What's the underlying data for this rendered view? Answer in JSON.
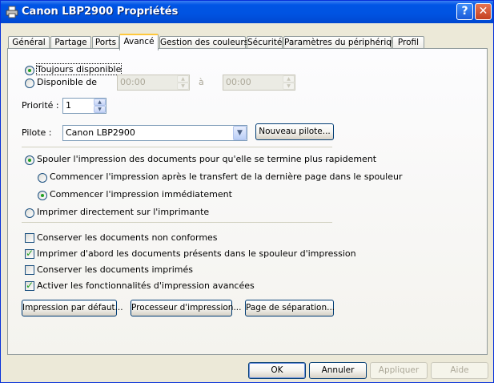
{
  "window": {
    "title": "Canon LBP2900 Propriétés",
    "help_label": "?",
    "close_label": "✕"
  },
  "tabs": [
    {
      "label": "Général"
    },
    {
      "label": "Partage"
    },
    {
      "label": "Ports"
    },
    {
      "label": "Avancé"
    },
    {
      "label": "Gestion des couleurs"
    },
    {
      "label": "Sécurité"
    },
    {
      "label": "Paramètres du périphérique"
    },
    {
      "label": "Profil"
    }
  ],
  "availability": {
    "always_label": "Toujours disponible",
    "from_label": "Disponible de",
    "from_time": "00:00",
    "to_label": "à",
    "to_time": "00:00"
  },
  "priority": {
    "label": "Priorité :",
    "value": "1"
  },
  "driver": {
    "label": "Pilote :",
    "value": "Canon LBP2900",
    "new_driver_label": "Nouveau pilote..."
  },
  "spool": {
    "spool_label": "Spouler l'impression des documents pour qu'elle se termine plus rapidement",
    "after_last_page_label": "Commencer l'impression après le transfert de la dernière page dans le spouleur",
    "immediately_label": "Commencer l'impression immédiatement",
    "direct_label": "Imprimer directement sur l'imprimante"
  },
  "options": {
    "hold_mismatched_label": "Conserver les documents non conformes",
    "print_spooled_first_label": "Imprimer d'abord les documents présents dans le spouleur d'impression",
    "keep_printed_label": "Conserver les documents imprimés",
    "advanced_features_label": "Activer les fonctionnalités d'impression avancées"
  },
  "panel_buttons": {
    "defaults_label": "Impression par défaut...",
    "processor_label": "Processeur d'impression...",
    "separator_label": "Page de séparation..."
  },
  "dialog_buttons": {
    "ok_label": "OK",
    "cancel_label": "Annuler",
    "apply_label": "Appliquer",
    "help_label": "Aide"
  },
  "icons": {
    "title": "printer-icon",
    "spin_up": "spin-up-arrow-icon",
    "spin_down": "spin-down-arrow-icon",
    "dropdown": "chevron-down-icon"
  }
}
